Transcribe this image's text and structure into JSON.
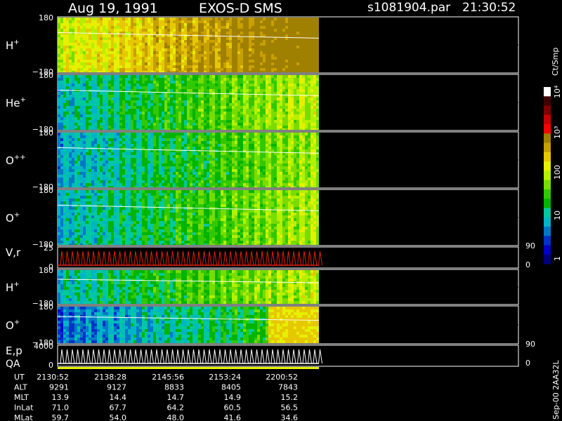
{
  "header": {
    "date": "Aug 19, 1991",
    "instrument": "EXOS-D SMS",
    "file": "s1081904.par",
    "time": "21:30:52"
  },
  "colorbar": {
    "unit_label": "Ct/Smp",
    "ticks": [
      "1",
      "10",
      "100",
      "10³",
      "10⁴"
    ],
    "colors": [
      "#00007f",
      "#0000c8",
      "#0032c8",
      "#0078c8",
      "#00b4c8",
      "#00c8a0",
      "#00b400",
      "#32c800",
      "#78dc00",
      "#b4f000",
      "#e6f000",
      "#e6c800",
      "#c8a000",
      "#a08000",
      "#ff0000",
      "#c80000",
      "#800000",
      "#400000",
      "#ffffff"
    ]
  },
  "chart_data": {
    "type": "heatmap",
    "panels": [
      {
        "label": "H⁺",
        "sup": "+",
        "base": "H",
        "ymax": "180",
        "ymin": "−180",
        "kind": "spectrogram",
        "level": 0.68
      },
      {
        "label": "He⁺",
        "sup": "+",
        "base": "He",
        "ymax": "180",
        "ymin": "−180",
        "kind": "spectrogram",
        "level": 0.32
      },
      {
        "label": "O⁺⁺",
        "sup": "++",
        "base": "O",
        "ymax": "180",
        "ymin": "−180",
        "kind": "spectrogram",
        "level": 0.28
      },
      {
        "label": "O⁺",
        "sup": "+",
        "base": "O",
        "ymax": "180",
        "ymin": "−180",
        "kind": "spectrogram",
        "level": 0.3
      },
      {
        "label": "V,r",
        "ymax": "25",
        "ymin": "0",
        "kind": "line",
        "right_ticks": [
          "90",
          "0"
        ],
        "line_color": "#e02010"
      },
      {
        "label": "H⁺",
        "sup": "+",
        "base": "H",
        "ymax": "180",
        "ymin": "−180",
        "kind": "spectrogram",
        "level": 0.32
      },
      {
        "label": "O⁺",
        "sup": "+",
        "base": "O",
        "ymax": "180",
        "ymin": "−180",
        "kind": "spectrogram",
        "level": 0.2
      },
      {
        "label": "E,p",
        "label2": "QA",
        "ymax": "4000",
        "ymin": "0",
        "kind": "line",
        "right_ticks": [
          "90",
          "0"
        ],
        "line_color": "#ffffff"
      }
    ],
    "footer_rows": [
      {
        "name": "UT",
        "values": [
          "2130:52",
          "2138:28",
          "2145:56",
          "2153:24",
          "2200:52"
        ]
      },
      {
        "name": "ALT",
        "values": [
          "9291",
          "9127",
          "8833",
          "8405",
          "7843"
        ]
      },
      {
        "name": "MLT",
        "values": [
          "13.9",
          "14.4",
          "14.7",
          "14.9",
          "15.2"
        ]
      },
      {
        "name": "InLat",
        "values": [
          "71.0",
          "67.7",
          "64.2",
          "60.5",
          "56.5"
        ]
      },
      {
        "name": "MLat",
        "values": [
          "59.7",
          "54.0",
          "48.0",
          "41.6",
          "34.6"
        ]
      }
    ]
  },
  "side_label": "Sep-00  2AA32L"
}
